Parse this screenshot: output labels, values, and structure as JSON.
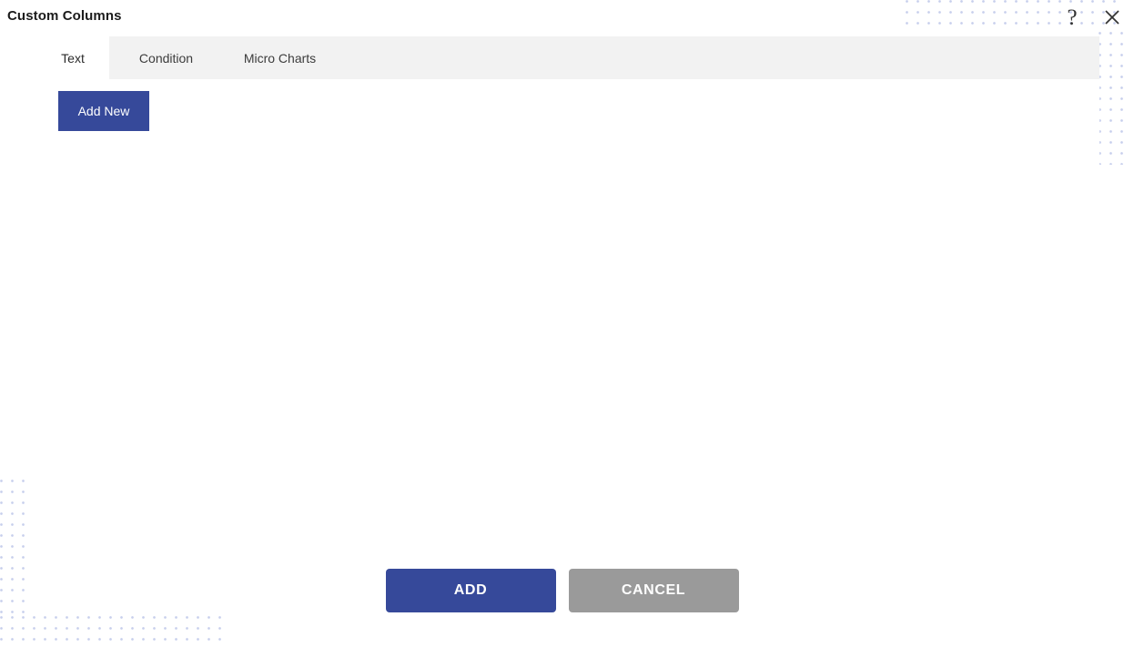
{
  "dialog": {
    "title": "Custom Columns",
    "help_icon": "question-mark-icon",
    "close_icon": "close-icon"
  },
  "tabs": [
    {
      "label": "Text",
      "active": true
    },
    {
      "label": "Condition",
      "active": false
    },
    {
      "label": "Micro Charts",
      "active": false
    }
  ],
  "panel": {
    "add_new_label": "Add New"
  },
  "footer": {
    "add_label": "ADD",
    "cancel_label": "CANCEL"
  },
  "colors": {
    "accent_blue": "#36499a",
    "cancel_gray": "#9a9a9a",
    "tabbar_gray": "#f2f2f2",
    "dot_pattern": "#9aa7dd"
  }
}
